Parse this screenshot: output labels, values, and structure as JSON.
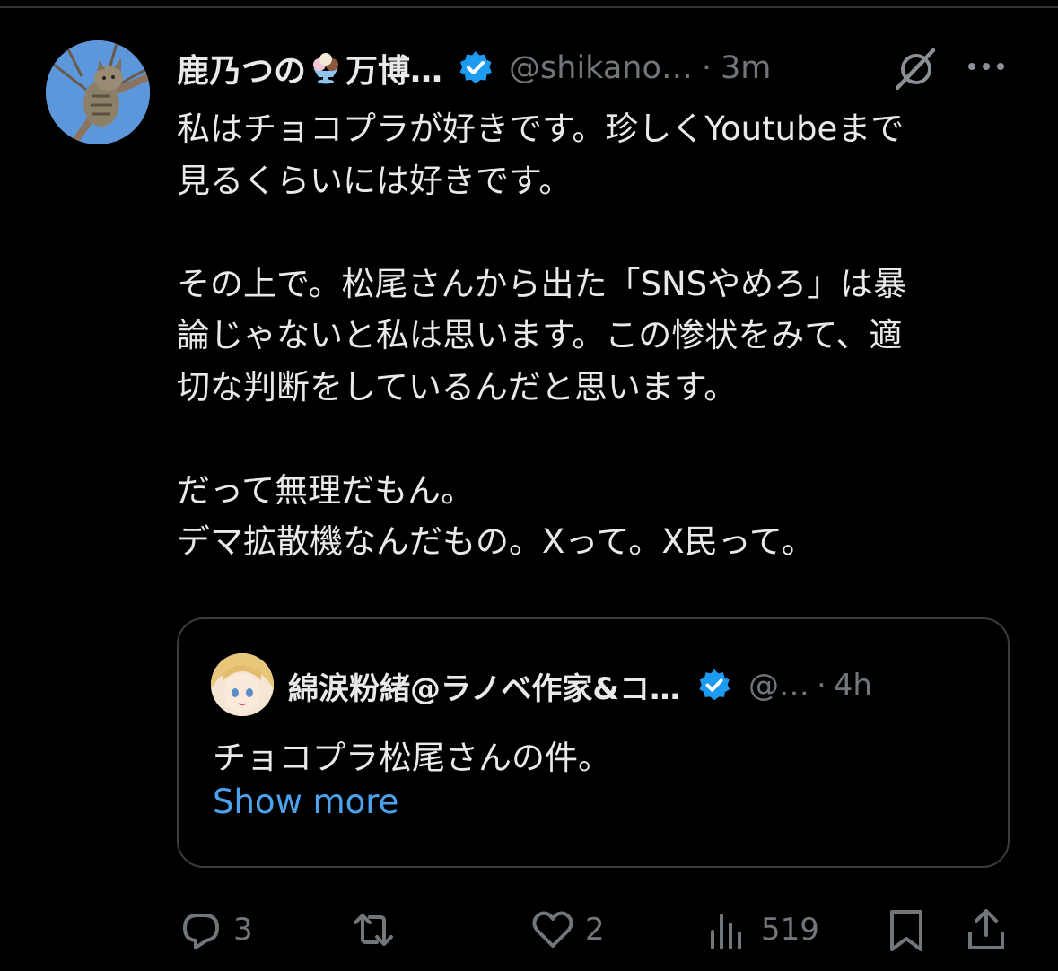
{
  "tweet": {
    "display_name": "鹿乃つの",
    "name_suffix": "万博…",
    "handle": "@shikano…",
    "dot": "·",
    "time": "3m",
    "paragraphs": [
      [
        "私はチョコプラが好きです。珍しくYoutubeまで",
        "見るくらいには好きです。"
      ],
      [
        "その上で。松尾さんから出た「SNSやめろ」は暴",
        "論じゃないと私は思います。この惨状をみて、適",
        "切な判断をしているんだと思います。"
      ],
      [
        "だって無理だもん。",
        "デマ拡散機なんだもの。Xって。X民って。"
      ]
    ]
  },
  "quote": {
    "display_name": "綿涙粉緒@ラノベ作家&コ…",
    "handle": "@…",
    "dot": "·",
    "time": "4h",
    "text": "チョコプラ松尾さんの件。",
    "show_more": "Show more"
  },
  "actions": {
    "reply_count": "3",
    "retweet_count": "",
    "like_count": "2",
    "view_count": "519"
  },
  "icons": {
    "verified": "verified-badge-icon",
    "grok": "grok-icon",
    "more": "more-icon",
    "reply": "reply-icon",
    "retweet": "retweet-icon",
    "like": "like-icon",
    "views": "views-icon",
    "bookmark": "bookmark-icon",
    "share": "share-icon"
  },
  "colors": {
    "background": "#000000",
    "text": "#e7e9ea",
    "secondary": "#71767b",
    "link": "#4da2ee",
    "verified": "#1d9bf0",
    "border": "#3a3d40"
  }
}
